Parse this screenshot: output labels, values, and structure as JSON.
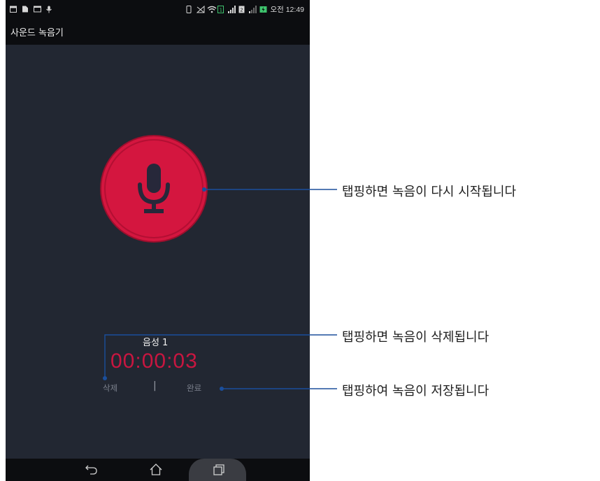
{
  "status_bar": {
    "time": "오전 12:49",
    "left_icons": [
      "calendar-icon",
      "document-icon",
      "gallery-icon",
      "microphone-icon"
    ],
    "right_icons": [
      "vibrate-icon",
      "no-signal-icon",
      "wifi-icon",
      "sim1-icon",
      "signal-icon",
      "sim2-icon",
      "signal-weak-icon",
      "battery-charging-icon"
    ]
  },
  "app_bar": {
    "title": "사운드 녹음기"
  },
  "recording": {
    "name": "음성 1",
    "elapsed": "00:00:03",
    "delete_label": "삭제",
    "separator": "|",
    "done_label": "완료"
  },
  "annotations": {
    "record": "탭핑하면 녹음이 다시 시작됩니다",
    "delete": "탭핑하면 녹음이 삭제됩니다",
    "save": "탭핑하여 녹음이 저장됩니다"
  },
  "colors": {
    "background": "#222732",
    "bars": "#0c0d10",
    "record": "#d4163f",
    "timer": "#c81640",
    "callout": "#1b4f9c"
  },
  "nav_icons": [
    "back-icon",
    "home-icon",
    "recent-apps-icon"
  ]
}
